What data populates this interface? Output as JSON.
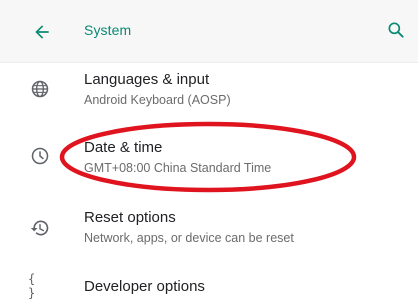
{
  "appbar": {
    "title": "System",
    "back_icon": "arrow-back-icon",
    "search_icon": "search-icon",
    "accent_color": "#0a8a74"
  },
  "items": [
    {
      "title": "Languages & input",
      "summary": "Android Keyboard (AOSP)",
      "icon": "globe-icon"
    },
    {
      "title": "Date & time",
      "summary": "GMT+08:00 China Standard Time",
      "icon": "clock-icon"
    },
    {
      "title": "Reset options",
      "summary": "Network, apps, or device can be reset",
      "icon": "restore-icon"
    },
    {
      "title": "Developer options",
      "icon": "braces-icon",
      "icon_text": "{ }"
    }
  ],
  "annotation": {
    "shape": "ellipse",
    "color": "#e0141e",
    "target": "Date & time"
  }
}
